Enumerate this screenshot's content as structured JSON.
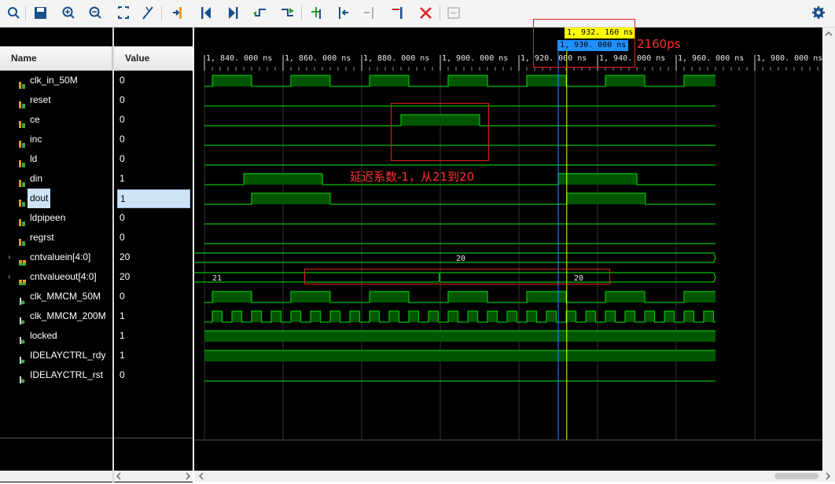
{
  "toolbar": {
    "buttons": [
      "search-icon",
      "save-icon",
      "zoom-in-icon",
      "zoom-out-icon",
      "zoom-fit-icon",
      "cursor-to-zero-icon",
      "go-to-cursor-icon",
      "go-to-start-icon",
      "go-to-end-icon",
      "previous-transition-icon",
      "next-transition-icon",
      "add-marker-icon",
      "previous-marker-icon",
      "next-marker-icon",
      "swap-cursors-icon",
      "delete-icon",
      "snap-icon",
      "settings-icon"
    ]
  },
  "columns": {
    "name": "Name",
    "value": "Value"
  },
  "signals": [
    {
      "name": "clk_in_50M",
      "value": "0",
      "icon": "bit-icon"
    },
    {
      "name": "reset",
      "value": "0",
      "icon": "bit-icon"
    },
    {
      "name": "ce",
      "value": "0",
      "icon": "bit-icon"
    },
    {
      "name": "inc",
      "value": "0",
      "icon": "bit-icon"
    },
    {
      "name": "ld",
      "value": "0",
      "icon": "bit-icon"
    },
    {
      "name": "din",
      "value": "1",
      "icon": "bit-icon"
    },
    {
      "name": "dout",
      "value": "1",
      "icon": "bit-icon",
      "selected": true
    },
    {
      "name": "ldpipeen",
      "value": "0",
      "icon": "bit-icon"
    },
    {
      "name": "regrst",
      "value": "0",
      "icon": "bit-icon"
    },
    {
      "name": "cntvaluein[4:0]",
      "value": "20",
      "icon": "bus-icon"
    },
    {
      "name": "cntvalueout[4:0]",
      "value": "20",
      "icon": "bus-icon"
    },
    {
      "name": "clk_MMCM_50M",
      "value": "0",
      "icon": "wire-icon"
    },
    {
      "name": "clk_MMCM_200M",
      "value": "1",
      "icon": "wire-icon"
    },
    {
      "name": "locked",
      "value": "1",
      "icon": "wire-icon"
    },
    {
      "name": "IDELAYCTRL_rdy",
      "value": "1",
      "icon": "wire-icon"
    },
    {
      "name": "IDELAYCTRL_rst",
      "value": "0",
      "icon": "wire-icon"
    }
  ],
  "timeline": {
    "unit": "ns",
    "ticks": [
      "1, 840. 000 ns",
      "1, 860. 000 ns",
      "1, 880. 000 ns",
      "1, 900. 000 ns",
      "1, 920. 000 ns",
      "1, 940. 000 ns",
      "1, 960. 000 ns",
      "1, 980. 000 ns"
    ],
    "tick_values": [
      1840,
      1860,
      1880,
      1900,
      1920,
      1940,
      1960,
      1980
    ]
  },
  "cursors": {
    "main": {
      "label": "1, 932. 160 ns",
      "time": 1932.16,
      "color": "#ffff00"
    },
    "secondary": {
      "label": "1, 930. 000 ns",
      "time": 1930.0,
      "color": "#2090ff"
    }
  },
  "bus_values": {
    "cntvaluein": [
      "20"
    ],
    "cntvalueout": [
      "21",
      "20"
    ]
  },
  "annotations": {
    "delay_label": "2160ps",
    "delay_note": "延迟系数-1，从21到20"
  },
  "colors": {
    "wave_green": "#00c000",
    "wave_fill": "#005500",
    "annotation_red": "#e02020"
  }
}
